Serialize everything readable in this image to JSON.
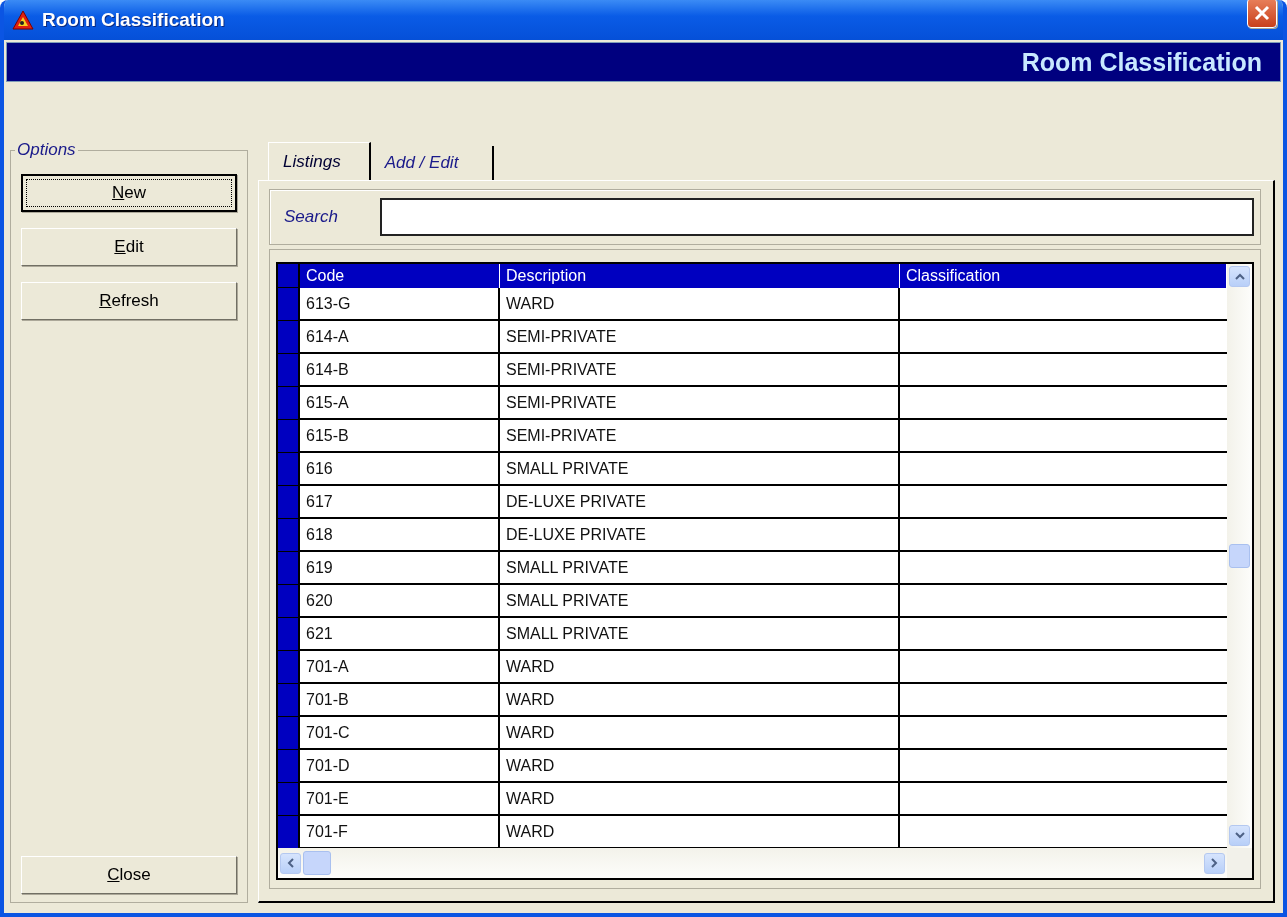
{
  "window": {
    "title": "Room Classification"
  },
  "header": {
    "title": "Room Classification"
  },
  "options": {
    "legend": "Options",
    "buttons": [
      {
        "label": "New",
        "focused": true,
        "underline_first": true
      },
      {
        "label": "Edit",
        "focused": false,
        "underline_first": true
      },
      {
        "label": "Refresh",
        "focused": false,
        "underline_first": true
      }
    ],
    "close_button": {
      "label": "Close",
      "underline_first": true
    }
  },
  "tabs": [
    {
      "label": "Listings",
      "selected": true
    },
    {
      "label": "Add / Edit",
      "selected": false
    }
  ],
  "search": {
    "label": "Search"
  },
  "table": {
    "columns": [
      "Code",
      "Description",
      "Classification"
    ],
    "rows": [
      [
        "613-G",
        "WARD",
        ""
      ],
      [
        "614-A",
        "SEMI-PRIVATE",
        ""
      ],
      [
        "614-B",
        "SEMI-PRIVATE",
        ""
      ],
      [
        "615-A",
        "SEMI-PRIVATE",
        ""
      ],
      [
        "615-B",
        "SEMI-PRIVATE",
        ""
      ],
      [
        "616",
        "SMALL PRIVATE",
        ""
      ],
      [
        "617",
        "DE-LUXE PRIVATE",
        ""
      ],
      [
        "618",
        "DE-LUXE PRIVATE",
        ""
      ],
      [
        "619",
        "SMALL PRIVATE",
        ""
      ],
      [
        "620",
        "SMALL PRIVATE",
        ""
      ],
      [
        "621",
        "SMALL PRIVATE",
        ""
      ],
      [
        "701-A",
        "WARD",
        ""
      ],
      [
        "701-B",
        "WARD",
        ""
      ],
      [
        "701-C",
        "WARD",
        ""
      ],
      [
        "701-D",
        "WARD",
        ""
      ],
      [
        "701-E",
        "WARD",
        ""
      ],
      [
        "701-F",
        "WARD",
        ""
      ]
    ]
  }
}
